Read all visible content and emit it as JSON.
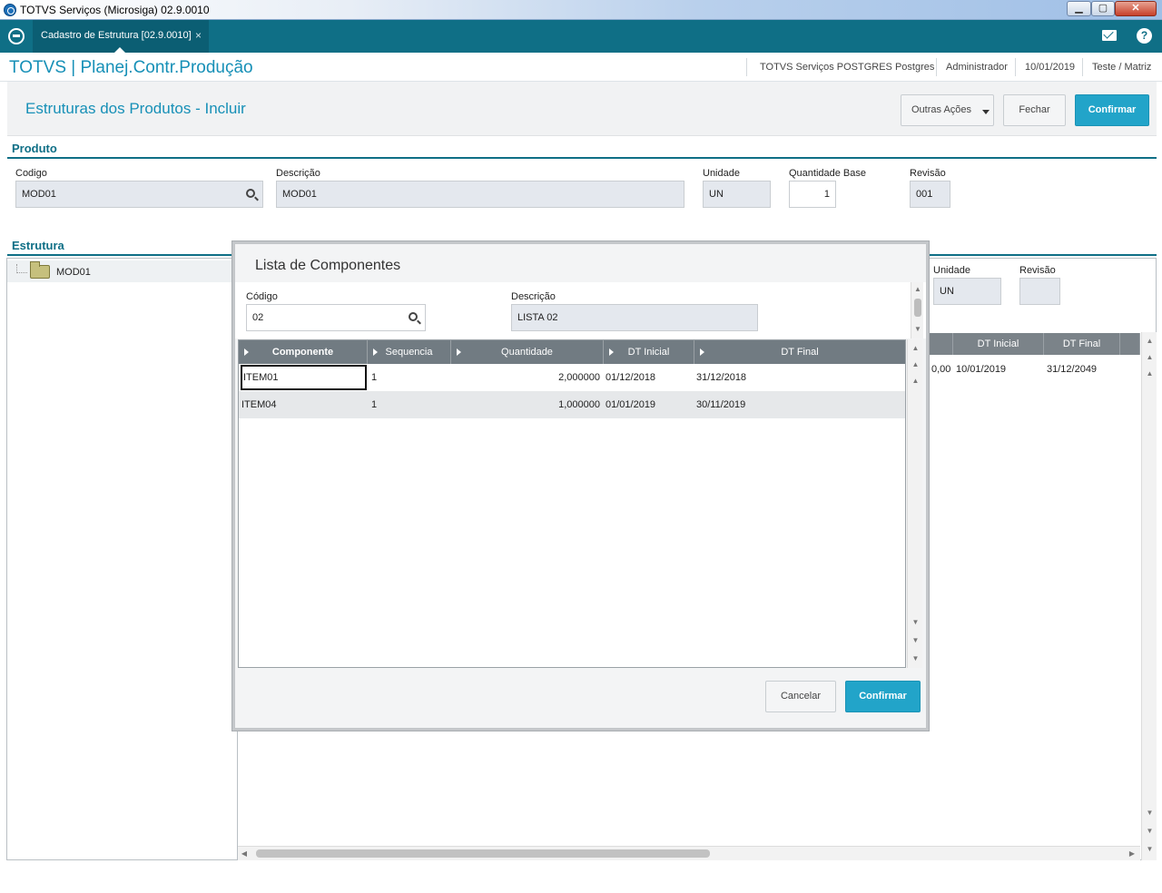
{
  "window": {
    "title": "TOTVS Serviços (Microsiga) 02.9.0010"
  },
  "tab": {
    "label": "Cadastro de Estrutura [02.9.0010]",
    "close": "×"
  },
  "module": {
    "name": "TOTVS | Planej.Contr.Produção",
    "environment": "TOTVS Serviços POSTGRES Postgres",
    "user": "Administrador",
    "date": "10/01/2019",
    "company": "Teste / Matriz"
  },
  "page": {
    "title": "Estruturas dos Produtos - Incluir",
    "actions": {
      "other": "Outras Ações",
      "close": "Fechar",
      "confirm": "Confirmar"
    }
  },
  "produto": {
    "section": "Produto",
    "codigo_label": "Codigo",
    "codigo_value": "MOD01",
    "descricao_label": "Descrição",
    "descricao_value": "MOD01",
    "unidade_label": "Unidade",
    "unidade_value": "UN",
    "qtdbase_label": "Quantidade Base",
    "qtdbase_value": "1",
    "revisao_label": "Revisão",
    "revisao_value": "001"
  },
  "estrutura": {
    "section": "Estrutura",
    "tree_item": "MOD01",
    "unidade_label": "Unidade",
    "unidade_value": "UN",
    "revisao_label": "Revisão",
    "revisao_value": "",
    "bg_headers": [
      "DT Inicial",
      "DT Final"
    ],
    "bg_row": {
      "qty": "0,00",
      "dt_inicial": "10/01/2019",
      "dt_final": "31/12/2049"
    }
  },
  "modal": {
    "title": "Lista de Componentes",
    "codigo_label": "Código",
    "codigo_value": "02",
    "descricao_label": "Descrição",
    "descricao_value": "LISTA 02",
    "columns": [
      "Componente",
      "Sequencia",
      "Quantidade",
      "DT Inicial",
      "DT Final"
    ],
    "rows": [
      {
        "componente": "ITEM01",
        "sequencia": "1",
        "quantidade": "2,000000",
        "dt_inicial": "01/12/2018",
        "dt_final": "31/12/2018"
      },
      {
        "componente": "ITEM04",
        "sequencia": "1",
        "quantidade": "1,000000",
        "dt_inicial": "01/01/2019",
        "dt_final": "30/11/2019"
      }
    ],
    "cancel": "Cancelar",
    "confirm": "Confirmar"
  }
}
